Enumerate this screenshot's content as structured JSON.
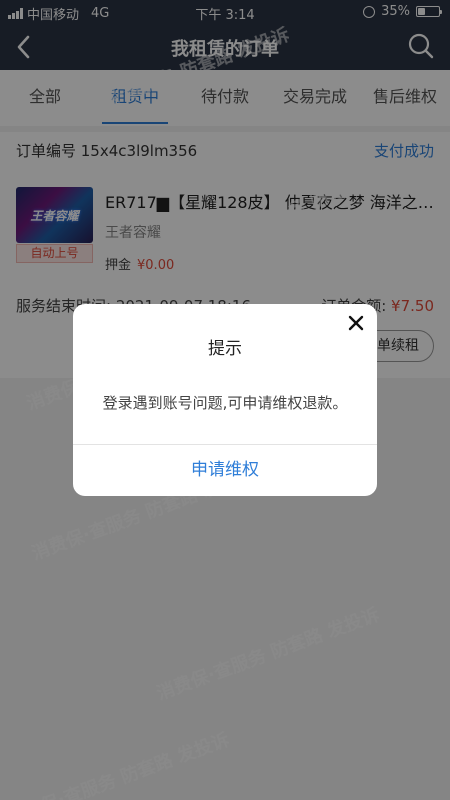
{
  "status_bar": {
    "carrier": "中国移动",
    "network": "4G",
    "time": "下午 3:14",
    "battery_percent": "35%",
    "battery_level": 0.35
  },
  "nav": {
    "title": "我租赁的订单",
    "back_icon": "chevron-left-icon",
    "search_icon": "search-icon"
  },
  "tabs": [
    {
      "label": "全部",
      "active": false
    },
    {
      "label": "租赁中",
      "active": true
    },
    {
      "label": "待付款",
      "active": false
    },
    {
      "label": "交易完成",
      "active": false
    },
    {
      "label": "售后维权",
      "active": false
    }
  ],
  "order": {
    "number_label": "订单编号 15x4c3l9lm356",
    "status": "支付成功",
    "thumbnail_text": "王者容耀",
    "auto_tag": "自动上号",
    "title": "ER717▆【星耀128皮】 仲夏夜之梦 海洋之…",
    "game": "王者容耀",
    "deposit_label": "押金",
    "deposit_amount": "¥0.00",
    "end_time": "服务结束时间: 2021-09-07 18:16",
    "amount_label": "订单金额: ",
    "amount_value": "¥7.50",
    "renew_button": "订单续租"
  },
  "watermark": {
    "text": "消费保·查服务 防套路 发投诉"
  },
  "dialog": {
    "title": "提示",
    "message": "登录遇到账号问题,可申请维权退款。",
    "action": "申请维权",
    "close_icon": "close-icon"
  },
  "colors": {
    "header_bg": "#2b3444",
    "accent": "#2f7ed8",
    "price_red": "#e04a3a"
  }
}
